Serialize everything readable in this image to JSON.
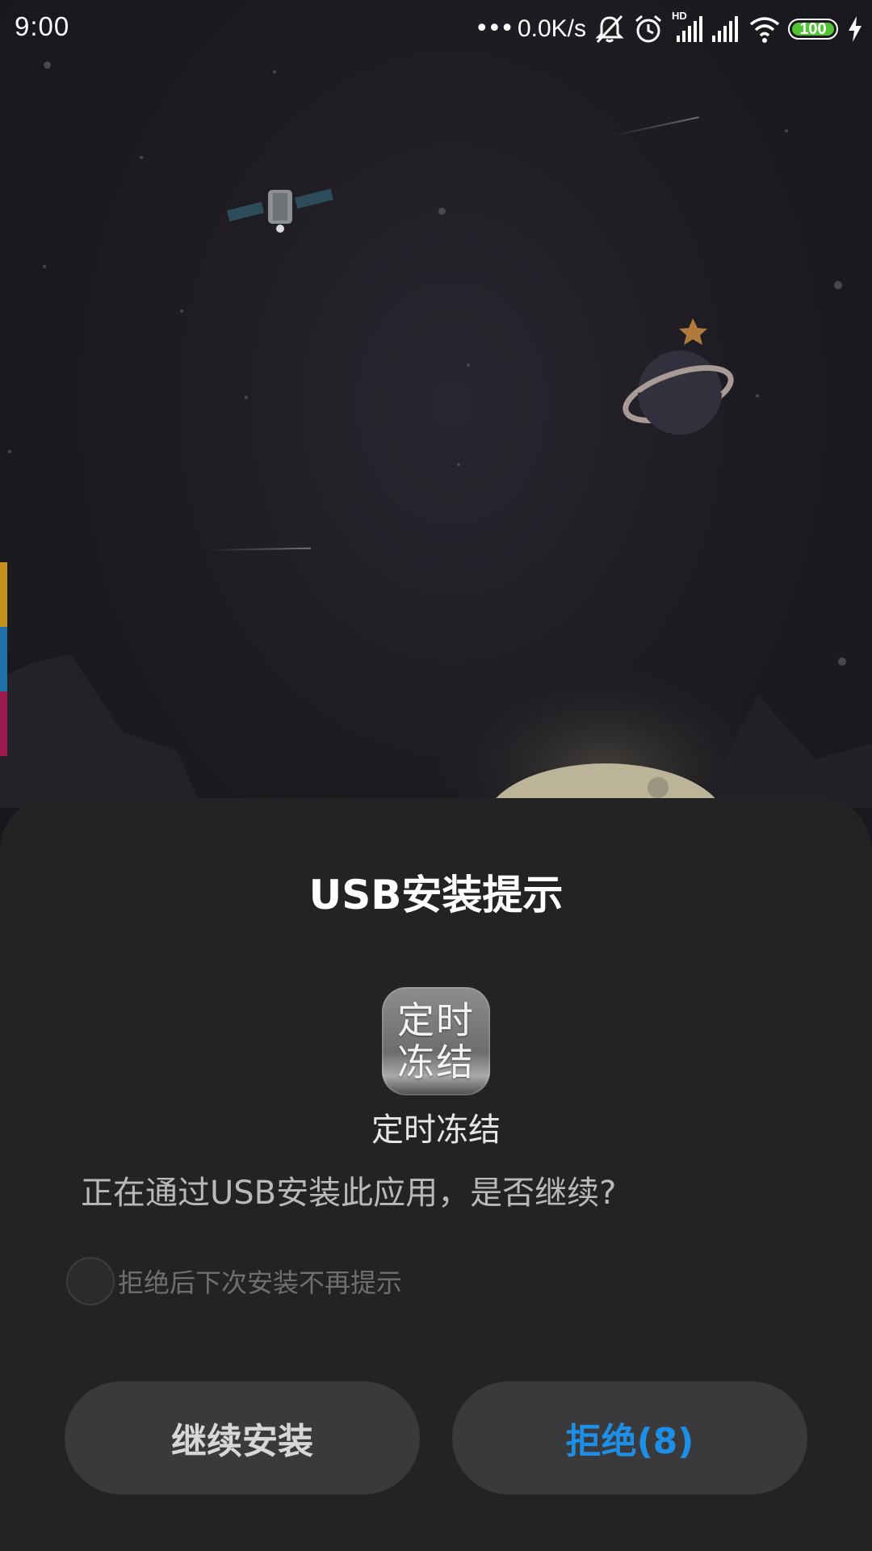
{
  "status_bar": {
    "time": "9:00",
    "dots": "•••",
    "net_speed": "0.0K/s",
    "hd_label": "HD",
    "battery_level": "100",
    "battery_color": "#52c234",
    "icons": [
      "mute-icon",
      "alarm-icon",
      "signal-icon",
      "signal-icon",
      "wifi-icon",
      "battery-icon",
      "charging-icon"
    ]
  },
  "dialog": {
    "title": "USB安装提示",
    "app_icon_text": [
      "定时",
      "冻结"
    ],
    "app_name": "定时冻结",
    "message": "正在通过USB安装此应用，是否继续?",
    "checkbox_label": "拒绝后下次安装不再提示",
    "checkbox_checked": false,
    "continue_label": "继续安装",
    "reject_label": "拒绝(8)",
    "reject_color": "#1e8fe6"
  },
  "side_stripe_colors": [
    "#c4921d",
    "#1f6fa8",
    "#a0194f"
  ]
}
